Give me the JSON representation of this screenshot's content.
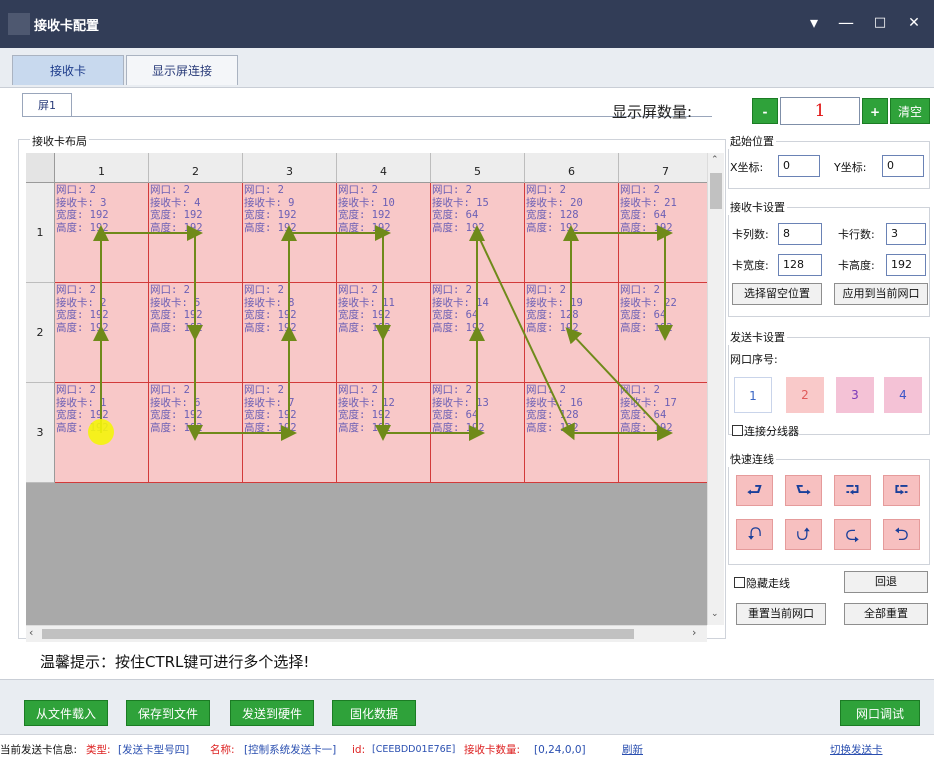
{
  "window": {
    "title": "接收卡配置",
    "controls": {
      "menu": "▾",
      "minimize": "—",
      "maximize": "□",
      "close": "✕"
    }
  },
  "tabs": [
    "接收卡",
    "显示屏连接"
  ],
  "screen_tab": "屏1",
  "screen_count": {
    "label": "显示屏数量:",
    "value": "1",
    "minus": "-",
    "plus": "+",
    "clear": "清空"
  },
  "layout": {
    "label": "接收卡布局",
    "columns": [
      "1",
      "2",
      "3",
      "4",
      "5",
      "6",
      "7"
    ],
    "rows": [
      "1",
      "2",
      "3"
    ],
    "field_labels": [
      "网口: ",
      "接收卡: ",
      "宽度: ",
      "高度: "
    ],
    "cells": [
      [
        {
          "port": "2",
          "card": "3",
          "width": "192",
          "height": "192"
        },
        {
          "port": "2",
          "card": "4",
          "width": "192",
          "height": "192"
        },
        {
          "port": "2",
          "card": "9",
          "width": "192",
          "height": "192"
        },
        {
          "port": "2",
          "card": "10",
          "width": "192",
          "height": "192"
        },
        {
          "port": "2",
          "card": "15",
          "width": "64",
          "height": "192"
        },
        {
          "port": "2",
          "card": "20",
          "width": "128",
          "height": "192"
        },
        {
          "port": "2",
          "card": "21",
          "width": "64",
          "height": "192"
        }
      ],
      [
        {
          "port": "2",
          "card": "2",
          "width": "192",
          "height": "192"
        },
        {
          "port": "2",
          "card": "5",
          "width": "192",
          "height": "192"
        },
        {
          "port": "2",
          "card": "8",
          "width": "192",
          "height": "192"
        },
        {
          "port": "2",
          "card": "11",
          "width": "192",
          "height": "192"
        },
        {
          "port": "2",
          "card": "14",
          "width": "64",
          "height": "192"
        },
        {
          "port": "2",
          "card": "19",
          "width": "128",
          "height": "192"
        },
        {
          "port": "2",
          "card": "22",
          "width": "64",
          "height": "192"
        }
      ],
      [
        {
          "port": "2",
          "card": "1",
          "width": "192",
          "height": "192"
        },
        {
          "port": "2",
          "card": "6",
          "width": "192",
          "height": "192"
        },
        {
          "port": "2",
          "card": "7",
          "width": "192",
          "height": "192"
        },
        {
          "port": "2",
          "card": "12",
          "width": "192",
          "height": "192"
        },
        {
          "port": "2",
          "card": "13",
          "width": "64",
          "height": "192"
        },
        {
          "port": "2",
          "card": "16",
          "width": "128",
          "height": "192"
        },
        {
          "port": "2",
          "card": "17",
          "width": "64",
          "height": "192"
        }
      ]
    ]
  },
  "tip": "温馨提示：按住CTRL键可进行多个选择!",
  "start_position": {
    "label": "起始位置",
    "x_label": "X坐标:",
    "x_value": "0",
    "y_label": "Y坐标:",
    "y_value": "0"
  },
  "card_settings": {
    "label": "接收卡设置",
    "cols_label": "卡列数:",
    "cols_value": "8",
    "rows_label": "卡行数:",
    "rows_value": "3",
    "width_label": "卡宽度:",
    "width_value": "128",
    "height_label": "卡高度:",
    "height_value": "192",
    "btn_reserve": "选择留空位置",
    "btn_apply": "应用到当前网口"
  },
  "sender_settings": {
    "label": "发送卡设置",
    "port_label": "网口序号:",
    "ports": [
      "1",
      "2",
      "3",
      "4"
    ],
    "splitter_label": "连接分线器"
  },
  "quick_link": {
    "label": "快速连线",
    "icons": [
      "⮐",
      "⮑",
      "⮒",
      "⮓",
      "⮏",
      "⮍",
      "⮎",
      "⮌"
    ]
  },
  "hide_trace_label": "隐藏走线",
  "buttons": {
    "undo": "回退",
    "reset_port": "重置当前网口",
    "reset_all": "全部重置"
  },
  "bottom_buttons": {
    "load": "从文件载入",
    "save": "保存到文件",
    "send": "发送到硬件",
    "solidify": "固化数据",
    "port_debug": "网口调试"
  },
  "status": {
    "prefix": "当前发送卡信息:",
    "type_label": "类型:",
    "type_value": "[发送卡型号四]",
    "name_label": "名称:",
    "name_value": "[控制系统发送卡一]",
    "id_label": "id:",
    "id_value": "[CEEBDD01E76E]",
    "count_label": "接收卡数量:",
    "count_value": "[0,24,0,0]",
    "refresh": "刷新",
    "switch": "切换发送卡"
  },
  "colors": {
    "titlebar": "#323d57",
    "button_green": "#2fa23a",
    "cell_pink": "#f8c8c8",
    "cell_border": "#d23a3a",
    "trace": "#6f8a1a"
  }
}
